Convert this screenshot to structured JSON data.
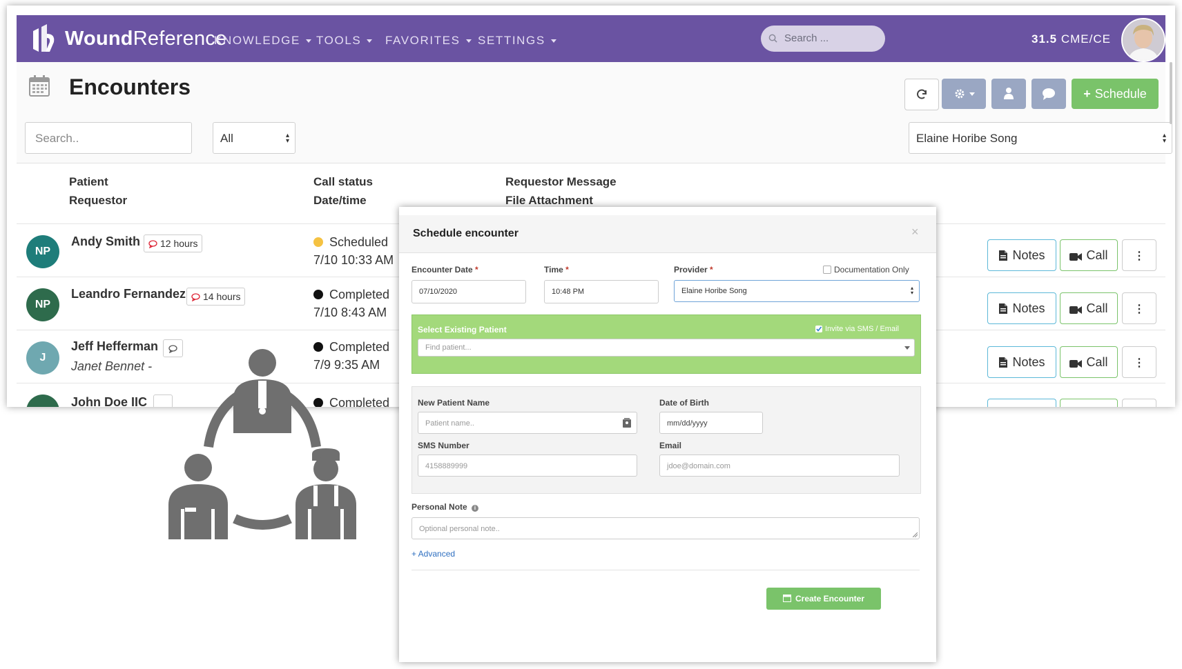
{
  "brand": {
    "name_bold": "Wound",
    "name_rest": "Reference"
  },
  "nav": {
    "menus": [
      "KNOWLEDGE",
      "TOOLS",
      "FAVORITES",
      "SETTINGS"
    ],
    "search_placeholder": "Search ...",
    "cme_value": "31.5",
    "cme_unit": "CME/CE"
  },
  "page": {
    "title": "Encounters",
    "schedule_label": "Schedule",
    "search_placeholder": "Search..",
    "filter_value": "All",
    "provider_value": "Elaine Horibe Song"
  },
  "table": {
    "headers": {
      "col1_line1": "Patient",
      "col1_line2": "Requestor",
      "col2_line1": "Call status",
      "col2_line2": "Date/time",
      "col3_line1": "Requestor Message",
      "col3_line2": "File Attachment"
    },
    "rows": [
      {
        "initials": "NP",
        "avatar_color": "#1e7d7a",
        "name": "Andy Smith",
        "badge": "12 hours",
        "requestor": "",
        "status": "Scheduled",
        "status_color": "#f5c242",
        "datetime": "7/10 10:33 AM"
      },
      {
        "initials": "NP",
        "avatar_color": "#2e6b4c",
        "name": "Leandro Fernandez",
        "badge": "14 hours",
        "requestor": "",
        "status": "Completed",
        "status_color": "#111111",
        "datetime": "7/10 8:43 AM"
      },
      {
        "initials": "J",
        "avatar_color": "#6fa8b0",
        "name": "Jeff Hefferman",
        "badge": "",
        "requestor": "Janet Bennet -",
        "status": "Completed",
        "status_color": "#111111",
        "datetime": "7/9 9:35 AM"
      },
      {
        "initials": "",
        "avatar_color": "#2e6b4c",
        "name": "John Doe IIC",
        "badge": "",
        "requestor": "",
        "status": "Completed",
        "status_color": "#111111",
        "datetime": ""
      }
    ],
    "actions": {
      "notes": "Notes",
      "call": "Call"
    }
  },
  "modal": {
    "title": "Schedule encounter",
    "close": "×",
    "encounter_date_label": "Encounter Date",
    "encounter_date_value": "07/10/2020",
    "time_label": "Time",
    "time_value": "10:48 PM",
    "provider_label": "Provider",
    "provider_value": "Elaine Horibe Song",
    "doc_only_label": "Documentation Only",
    "required_mark": "*",
    "select_patient_label": "Select Existing Patient",
    "invite_label": "Invite via SMS / Email",
    "find_patient_placeholder": "Find patient...",
    "new_patient_label": "New Patient Name",
    "patient_name_placeholder": "Patient name..",
    "dob_label": "Date of Birth",
    "dob_placeholder": "mm/dd/yyyy",
    "sms_label": "SMS Number",
    "sms_placeholder": "4158889999",
    "email_label": "Email",
    "email_placeholder": "jdoe@domain.com",
    "note_label": "Personal Note",
    "note_placeholder": "Optional personal note..",
    "advanced_label": "+ Advanced",
    "create_label": "Create Encounter"
  },
  "colors": {
    "nav_purple": "#6a53a2",
    "schedule_green": "#7ac36a",
    "notes_border": "#5bb8d8",
    "call_border": "#7ac36a",
    "gray_button": "#9aa7c3",
    "select_patient_green": "#a3d97b"
  }
}
